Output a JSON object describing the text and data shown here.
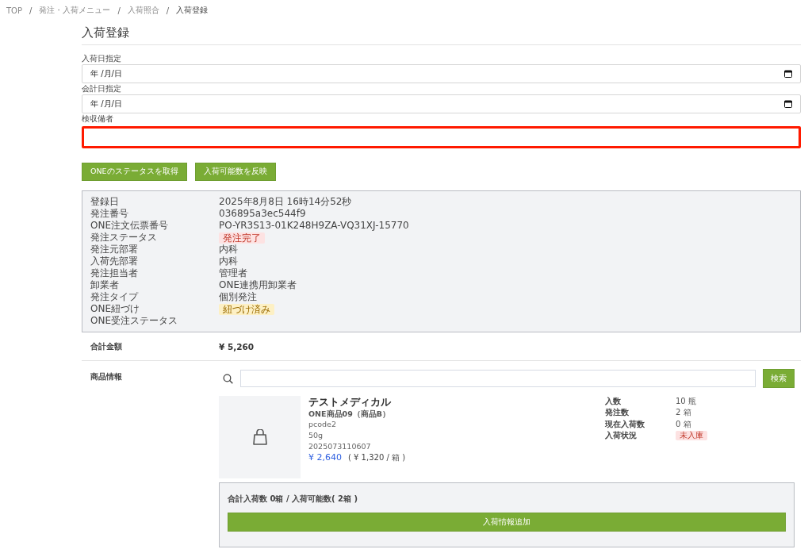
{
  "breadcrumb": [
    {
      "label": "TOP"
    },
    {
      "sep": "/",
      "label": "発注・入荷メニュー"
    },
    {
      "sep": "/",
      "label": "入荷照合"
    },
    {
      "sep": "/",
      "label": "入荷登録"
    }
  ],
  "title": "入荷登録",
  "fields": [
    {
      "label": "入荷日指定",
      "kind": "date",
      "value": "年 /月/日",
      "highlighted": false
    },
    {
      "label": "会計日指定",
      "kind": "date",
      "value": "年 /月/日",
      "highlighted": false
    },
    {
      "label": "検収備者",
      "kind": "text",
      "highlighted": true
    }
  ],
  "actions": [
    "ONEのステータスを取得",
    "入荷可能数を反映"
  ],
  "details": [
    {
      "label": "登録日",
      "value": "2025年8月8日 16時14分52秒"
    },
    {
      "label": "発注番号",
      "value": "036895a3ec544f9"
    },
    {
      "label": "ONE注文伝票番号",
      "value": "PO-YR3S13-01K248H9ZA-VQ31XJ-15770"
    },
    {
      "label": "発注ステータス",
      "badge": "発注完了",
      "color": "#fde2e2"
    },
    {
      "label": "発注元部署",
      "value": "内科"
    },
    {
      "label": "入荷先部署",
      "value": "内科"
    },
    {
      "label": "発注担当者",
      "value": "管理者"
    },
    {
      "label": "卸業者",
      "value": "ONE連携用卸業者"
    },
    {
      "label": "発注タイプ",
      "value": "個別発注"
    },
    {
      "label": "ONE紐づけ",
      "badge": "紐づけ済み",
      "color": "#fdf0c4"
    },
    {
      "label": "ONE受注ステータス"
    }
  ],
  "total": {
    "label": "合計金額",
    "value": "¥ 5,260"
  },
  "products": {
    "label": "商品情報",
    "search_button": "検索",
    "item": {
      "maker": "テストメディカル",
      "name": "ONE商品09（商品B）",
      "code": "pcode2",
      "size": "50g",
      "jan": "2025073110607",
      "price": "¥ 2,640",
      "unit_price": "( ¥ 1,320 / 箱 )",
      "stats": [
        {
          "label": "入数",
          "value": "10 瓶"
        },
        {
          "label": "発注数",
          "value": "2 箱"
        },
        {
          "label": "現在入荷数",
          "value": "0 箱"
        },
        {
          "label": "入荷状況",
          "badge": "未入庫",
          "color": "#fde2e2"
        }
      ]
    },
    "summary": "合計入荷数 0箱 / 入荷可能数( 2箱 )",
    "add_button": "入荷情報追加"
  }
}
